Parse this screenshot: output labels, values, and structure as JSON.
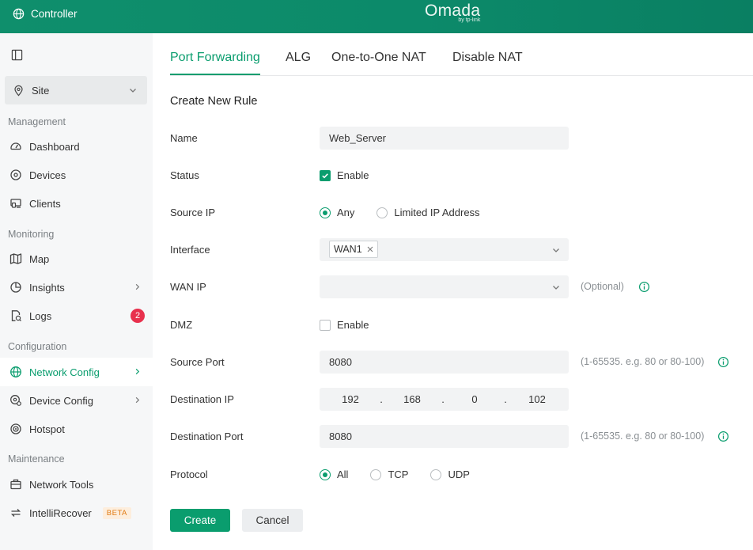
{
  "topbar": {
    "controller_label": "Controller",
    "brand": "Omada",
    "brand_by": "by tp-link"
  },
  "sidebar": {
    "site_label": "Site",
    "sections": {
      "management": "Management",
      "monitoring": "Monitoring",
      "configuration": "Configuration",
      "maintenance": "Maintenance"
    },
    "items": {
      "dashboard": "Dashboard",
      "devices": "Devices",
      "clients": "Clients",
      "map": "Map",
      "insights": "Insights",
      "logs": "Logs",
      "logs_badge": "2",
      "network_config": "Network Config",
      "device_config": "Device Config",
      "hotspot": "Hotspot",
      "network_tools": "Network Tools",
      "intellirecover": "IntelliRecover",
      "beta": "BETA"
    },
    "active_item": "network_config",
    "accent_color": "#0a9d6e"
  },
  "tabs": [
    "Port Forwarding",
    "ALG",
    "One-to-One NAT",
    "Disable NAT"
  ],
  "form": {
    "title": "Create New Rule",
    "name": {
      "label": "Name",
      "value": "Web_Server"
    },
    "status": {
      "label": "Status",
      "option": "Enable",
      "checked": true
    },
    "source_ip": {
      "label": "Source IP",
      "options": [
        "Any",
        "Limited IP Address"
      ],
      "selected": "Any"
    },
    "interface": {
      "label": "Interface",
      "tag": "WAN1"
    },
    "wan_ip": {
      "label": "WAN IP",
      "value": "",
      "hint": "(Optional)"
    },
    "dmz": {
      "label": "DMZ",
      "option": "Enable",
      "checked": false
    },
    "source_port": {
      "label": "Source Port",
      "value": "8080",
      "hint": "(1-65535. e.g. 80 or 80-100)"
    },
    "destination_ip": {
      "label": "Destination IP",
      "octets": [
        "192",
        "168",
        "0",
        "102"
      ],
      "dot": "."
    },
    "destination_port": {
      "label": "Destination Port",
      "value": "8080",
      "hint": "(1-65535. e.g. 80 or 80-100)"
    },
    "protocol": {
      "label": "Protocol",
      "options": [
        "All",
        "TCP",
        "UDP"
      ],
      "selected": "All"
    },
    "create_label": "Create",
    "cancel_label": "Cancel"
  }
}
